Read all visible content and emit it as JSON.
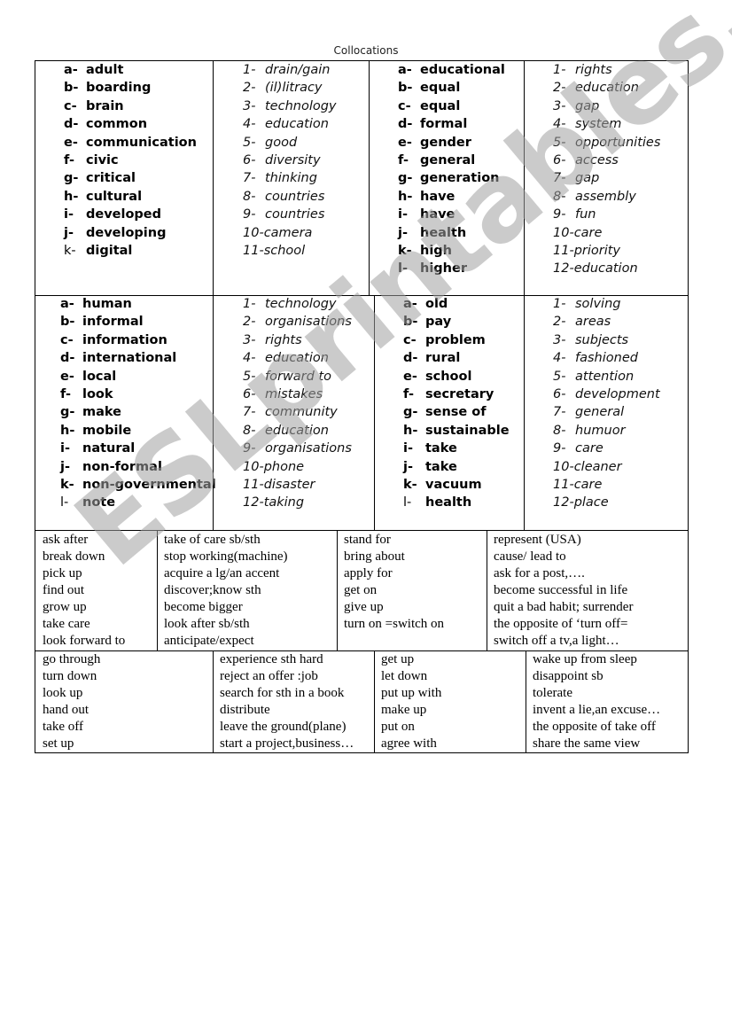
{
  "document": {
    "title": "Collocations",
    "watermark": "ESLprintables.com"
  },
  "collocations": {
    "block1": {
      "adjectives": [
        {
          "marker": "a-",
          "word": "adult"
        },
        {
          "marker": "b-",
          "word": "boarding"
        },
        {
          "marker": "c-",
          "word": "brain"
        },
        {
          "marker": "d-",
          "word": "common"
        },
        {
          "marker": "e-",
          "word": "communication"
        },
        {
          "marker": "f-",
          "word": "civic"
        },
        {
          "marker": "g-",
          "word": "critical"
        },
        {
          "marker": "h-",
          "word": "cultural"
        },
        {
          "marker": "i-",
          "word": "developed"
        },
        {
          "marker": "j-",
          "word": "developing"
        },
        {
          "marker": "k-",
          "word": "digital"
        }
      ],
      "nouns": [
        {
          "marker": "1-",
          "word": "drain/gain"
        },
        {
          "marker": "2-",
          "word": "(il)litracy"
        },
        {
          "marker": "3-",
          "word": "technology"
        },
        {
          "marker": "4-",
          "word": "education"
        },
        {
          "marker": "5-",
          "word": "good"
        },
        {
          "marker": "6-",
          "word": "diversity"
        },
        {
          "marker": "7-",
          "word": "thinking"
        },
        {
          "marker": "8-",
          "word": "countries"
        },
        {
          "marker": "9-",
          "word": "countries"
        },
        {
          "marker": "10-",
          "word": "camera"
        },
        {
          "marker": "11-",
          "word": "school"
        }
      ]
    },
    "block2": {
      "adjectives": [
        {
          "marker": "a-",
          "word": "educational"
        },
        {
          "marker": "b-",
          "word": "equal"
        },
        {
          "marker": "c-",
          "word": "equal"
        },
        {
          "marker": "d-",
          "word": "formal"
        },
        {
          "marker": "e-",
          "word": "gender"
        },
        {
          "marker": "f-",
          "word": "general"
        },
        {
          "marker": "g-",
          "word": "generation"
        },
        {
          "marker": "h-",
          "word": "have"
        },
        {
          "marker": "i-",
          "word": "have"
        },
        {
          "marker": "j-",
          "word": "health"
        },
        {
          "marker": "k-",
          "word": "high"
        },
        {
          "marker": "l-",
          "word": "higher"
        }
      ],
      "nouns": [
        {
          "marker": "1-",
          "word": "rights"
        },
        {
          "marker": "2-",
          "word": "education"
        },
        {
          "marker": "3-",
          "word": "gap"
        },
        {
          "marker": "4-",
          "word": "system"
        },
        {
          "marker": "5-",
          "word": "opportunities"
        },
        {
          "marker": "6-",
          "word": "access"
        },
        {
          "marker": "7-",
          "word": "gap"
        },
        {
          "marker": "8-",
          "word": "assembly"
        },
        {
          "marker": "9-",
          "word": "fun"
        },
        {
          "marker": "10-",
          "word": "care"
        },
        {
          "marker": "11-",
          "word": "priority"
        },
        {
          "marker": "12-",
          "word": "education"
        }
      ]
    },
    "block3": {
      "adjectives": [
        {
          "marker": "a-",
          "word": "human"
        },
        {
          "marker": "b-",
          "word": "informal"
        },
        {
          "marker": "c-",
          "word": "information"
        },
        {
          "marker": "d-",
          "word": "international"
        },
        {
          "marker": "e-",
          "word": "local"
        },
        {
          "marker": "f-",
          "word": "look"
        },
        {
          "marker": "g-",
          "word": "make"
        },
        {
          "marker": "h-",
          "word": "mobile"
        },
        {
          "marker": "i-",
          "word": "natural"
        },
        {
          "marker": "j-",
          "word": "non-formal"
        },
        {
          "marker": "k-",
          "word": "non-governmental"
        },
        {
          "marker": "l-",
          "word": "note"
        }
      ],
      "nouns": [
        {
          "marker": "1-",
          "word": "technology"
        },
        {
          "marker": "2-",
          "word": "organisations"
        },
        {
          "marker": "3-",
          "word": "rights"
        },
        {
          "marker": "4-",
          "word": "education"
        },
        {
          "marker": "5-",
          "word": "forward to"
        },
        {
          "marker": "6-",
          "word": "mistakes"
        },
        {
          "marker": "7-",
          "word": "community"
        },
        {
          "marker": "8-",
          "word": "education"
        },
        {
          "marker": "9-",
          "word": "organisations"
        },
        {
          "marker": "10-",
          "word": "phone"
        },
        {
          "marker": "11-",
          "word": "disaster"
        },
        {
          "marker": "12-",
          "word": "taking"
        }
      ]
    },
    "block4": {
      "adjectives": [
        {
          "marker": "a-",
          "word": "old"
        },
        {
          "marker": "b-",
          "word": "pay"
        },
        {
          "marker": "c-",
          "word": "problem"
        },
        {
          "marker": "d-",
          "word": "rural"
        },
        {
          "marker": "e-",
          "word": "school"
        },
        {
          "marker": "f-",
          "word": "secretary"
        },
        {
          "marker": "g-",
          "word": "sense of"
        },
        {
          "marker": "h-",
          "word": "sustainable"
        },
        {
          "marker": "i-",
          "word": "take"
        },
        {
          "marker": "j-",
          "word": "take"
        },
        {
          "marker": "k-",
          "word": "vacuum"
        },
        {
          "marker": "l-",
          "word": "health"
        }
      ],
      "nouns": [
        {
          "marker": "1-",
          "word": "solving"
        },
        {
          "marker": "2-",
          "word": "areas"
        },
        {
          "marker": "3-",
          "word": "subjects"
        },
        {
          "marker": "4-",
          "word": "fashioned"
        },
        {
          "marker": "5-",
          "word": "attention"
        },
        {
          "marker": "6-",
          "word": "development"
        },
        {
          "marker": "7-",
          "word": "general"
        },
        {
          "marker": "8-",
          "word": "humuor"
        },
        {
          "marker": "9-",
          "word": "care"
        },
        {
          "marker": "10-",
          "word": "cleaner"
        },
        {
          "marker": "11-",
          "word": "care"
        },
        {
          "marker": "12-",
          "word": "place"
        }
      ]
    }
  },
  "phrasal_verbs": {
    "table1": {
      "verbs_a": [
        "ask after",
        "break down",
        "pick up",
        "find out",
        "grow up",
        "take care",
        "look forward to"
      ],
      "meanings_a": [
        "take of care sb/sth",
        "stop working(machine)",
        "acquire a lg/an accent",
        "discover;know sth",
        "become bigger",
        "look after sb/sth",
        "anticipate/expect"
      ],
      "verbs_b": [
        "stand for",
        "bring about",
        "apply for",
        "get on",
        "give up",
        "turn on =switch on"
      ],
      "meanings_b": [
        "represent (USA)",
        "cause/ lead to",
        "ask for a post,….",
        "become successful in life",
        "quit a bad habit; surrender",
        "the opposite of ‘turn off=",
        "switch off a tv,a light…"
      ]
    },
    "table2": {
      "verbs_a": [
        "go through",
        "turn down",
        "look up",
        "hand out",
        "take off",
        "set up"
      ],
      "meanings_a": [
        "experience sth hard",
        "reject an offer :job",
        "search for sth in a book",
        "distribute",
        "leave the ground(plane)",
        "start a project,business…"
      ],
      "verbs_b": [
        "get up",
        "let down",
        "put up with",
        "make up",
        "put on",
        "agree with"
      ],
      "meanings_b": [
        "wake up from sleep",
        "disappoint sb",
        "tolerate",
        "invent a lie,an excuse…",
        "the opposite of  take off",
        "share the same view"
      ]
    }
  }
}
